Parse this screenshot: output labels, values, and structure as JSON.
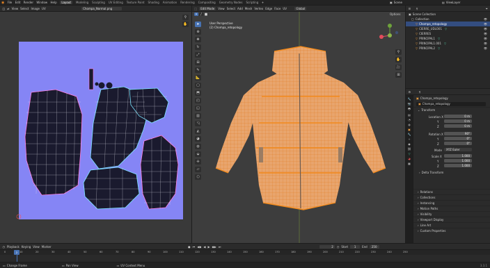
{
  "app_menu": {
    "items": [
      "File",
      "Edit",
      "Render",
      "Window",
      "Help"
    ]
  },
  "workspaces": {
    "items": [
      "Layout",
      "Modeling",
      "Sculpting",
      "UV Editing",
      "Texture Paint",
      "Shading",
      "Animation",
      "Rendering",
      "Compositing",
      "Geometry Nodes",
      "Scripting"
    ],
    "active": "Layout"
  },
  "scene_field": {
    "label": "Scene"
  },
  "viewlayer_field": {
    "label": "ViewLayer"
  },
  "uv_editor": {
    "menus": [
      "View",
      "Select",
      "Image",
      "UV"
    ],
    "image_name": "Chompa_Normal.png"
  },
  "viewport": {
    "mode": "Edit Mode",
    "menus": [
      "View",
      "Select",
      "Add",
      "Mesh",
      "Vertex",
      "Edge",
      "Face",
      "UV"
    ],
    "orientation": "Global",
    "options_label": "Options",
    "info_title": "User Perspective",
    "info_object": "(2) Chompa_retopology"
  },
  "outliner": {
    "title": "Scene Collection",
    "items": [
      {
        "label": "Collection"
      },
      {
        "label": "Chompa_retopology"
      },
      {
        "label": "CIERRE_UDLO01"
      },
      {
        "label": "CIERRES"
      },
      {
        "label": "PRINCIPAL1"
      },
      {
        "label": "PRINCIPAL1.001"
      },
      {
        "label": "PRINCIPAL2"
      }
    ]
  },
  "properties": {
    "object_name": "Chompa_retopology",
    "object_field": "Chompa_retopology",
    "transform_label": "Transform",
    "location": {
      "label": "Location X",
      "x": "0 m",
      "y": "0 m",
      "z": "0 m"
    },
    "rotation": {
      "label": "Rotation X",
      "x": "90°",
      "y": "0°",
      "z": "0°"
    },
    "mode": {
      "label": "Mode",
      "value": "XYZ Euler"
    },
    "scale": {
      "label": "Scale X",
      "x": "1.000",
      "y": "1.000",
      "z": "1.000"
    },
    "axis_y": "Y",
    "axis_z": "Z",
    "delta_label": "Delta Transform",
    "sections": [
      "Relations",
      "Collections",
      "Instancing",
      "Motion Paths",
      "Visibility",
      "Viewport Display",
      "Line Art",
      "Custom Properties"
    ]
  },
  "timeline": {
    "menus": [
      "Playback",
      "Keying",
      "View",
      "Marker"
    ],
    "current_frame": "2",
    "start_label": "Start",
    "start": "1",
    "end_label": "End",
    "end": "250",
    "ticks": [
      "0",
      "10",
      "20",
      "30",
      "40",
      "50",
      "60",
      "70",
      "80",
      "90",
      "100",
      "110",
      "120",
      "130",
      "140",
      "150",
      "160",
      "170",
      "180",
      "190",
      "200",
      "210",
      "220",
      "230",
      "240",
      "250"
    ]
  },
  "statusbar": {
    "items": [
      "Change Frame",
      "Pan View",
      "UV Context Menu"
    ],
    "version": "3.3.1"
  }
}
